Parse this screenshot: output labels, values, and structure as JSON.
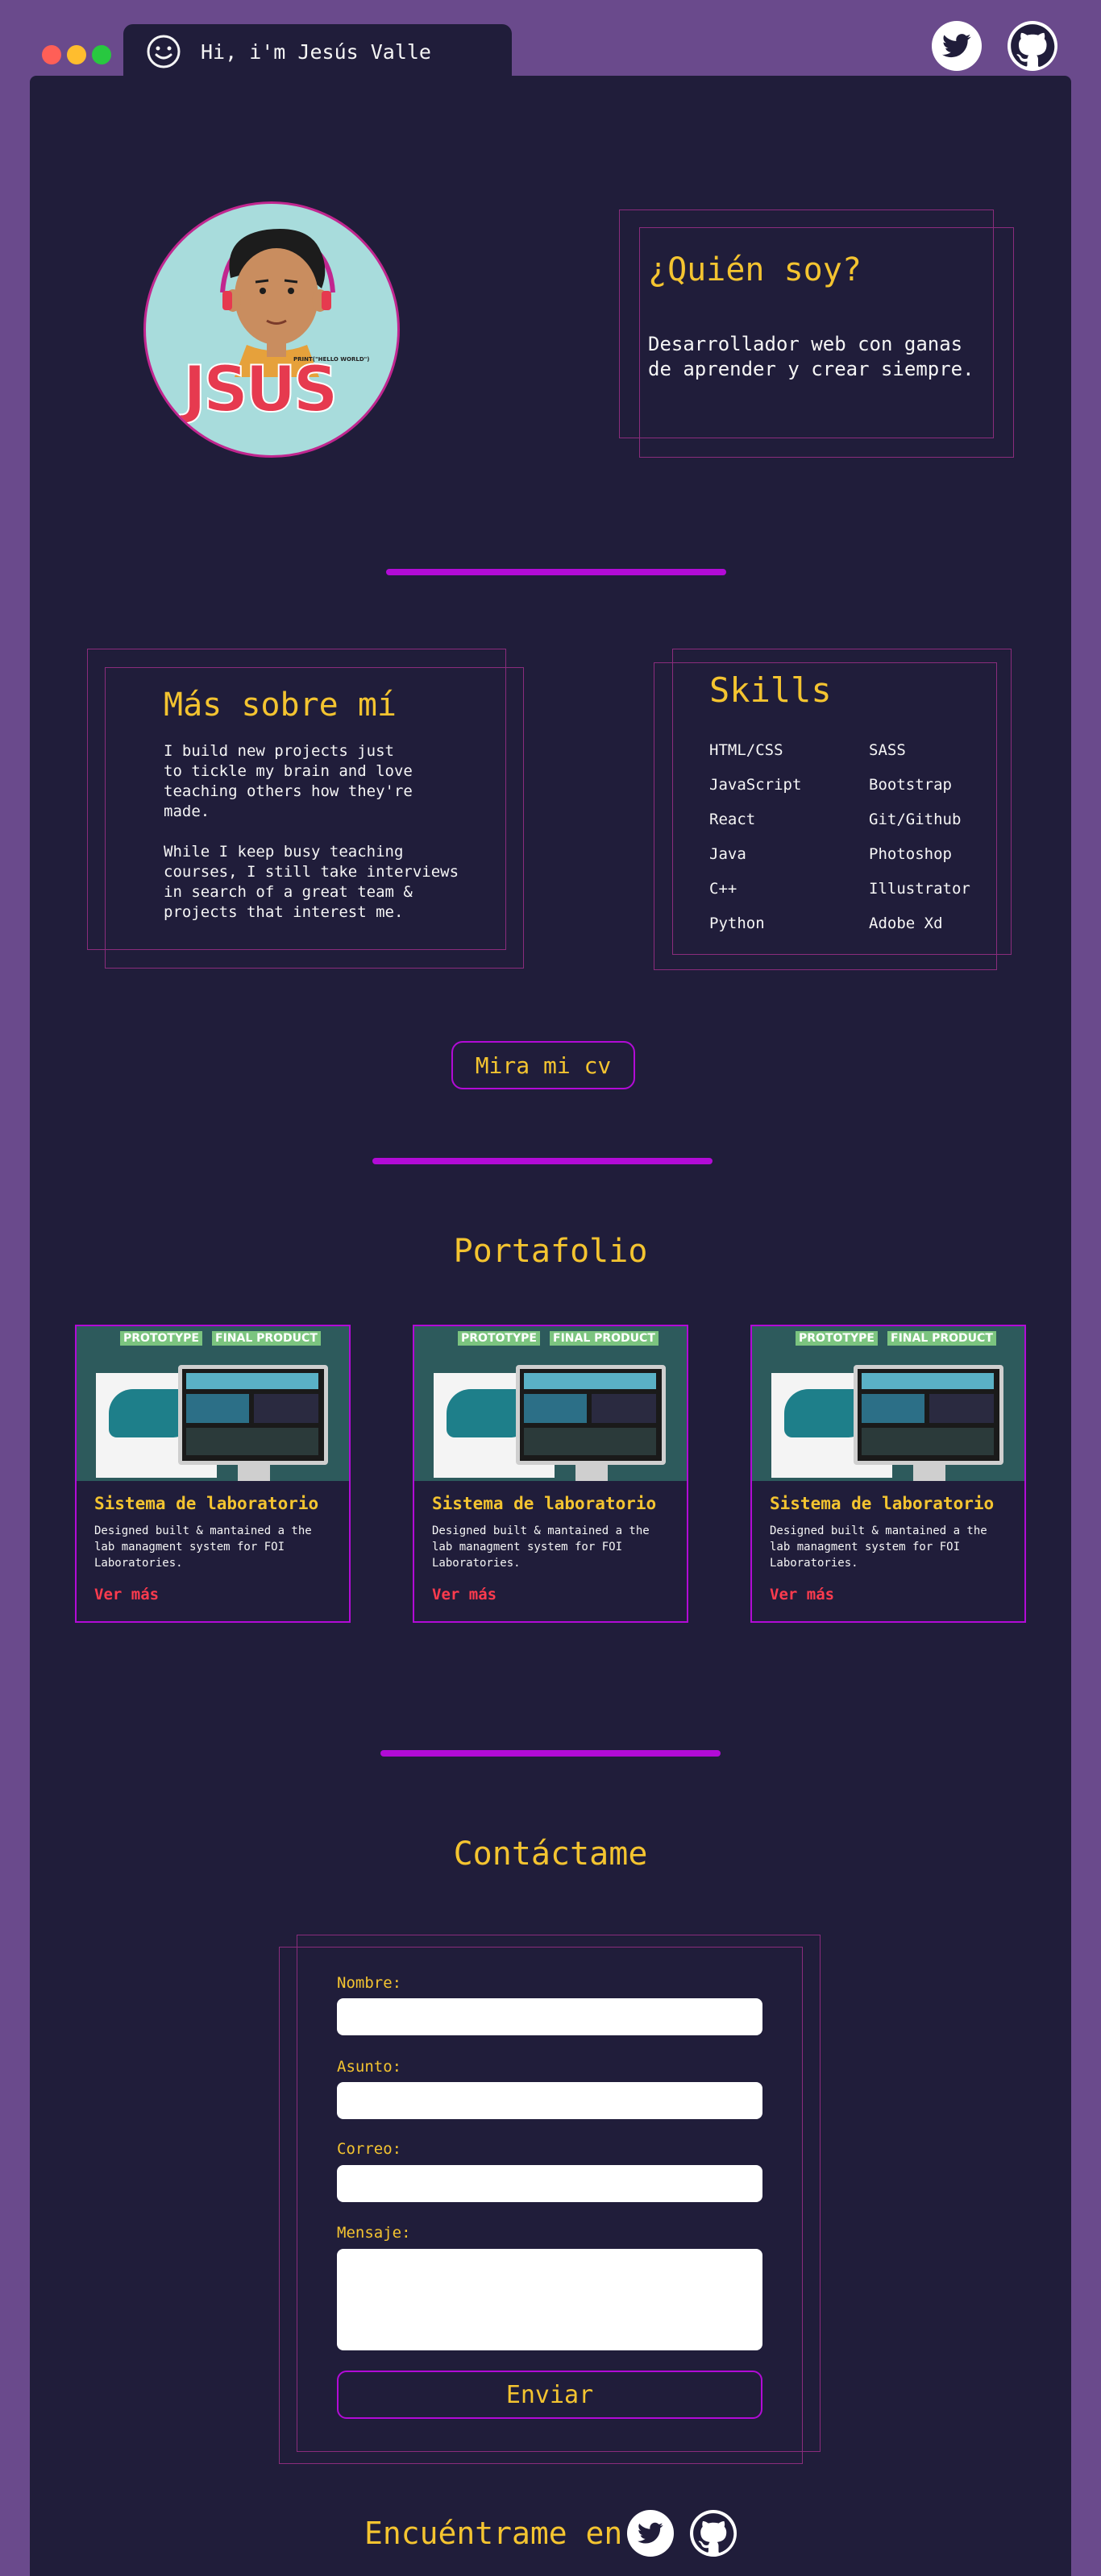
{
  "window": {
    "title": "Hi, i'm Jesús Valle",
    "controls": {
      "close_color": "#ff5f57",
      "minimize_color": "#ffbd2e",
      "maximize_color": "#28c840"
    }
  },
  "header_social": [
    "twitter-icon",
    "github-icon"
  ],
  "about": {
    "avatar_text": "JSUS",
    "avatar_small_text": "PRINT(\"HELLO WORLD\")",
    "who_title": "¿Quién soy?",
    "who_text": "Desarrollador web con ganas de aprender y crear siempre."
  },
  "more": {
    "title": "Más sobre mí",
    "text": "I build new projects just\nto tickle my brain and love\nteaching others how they're\nmade.\n\nWhile I keep busy teaching\ncourses, I still take interviews\nin search of a great team &\nprojects that interest me."
  },
  "skills": {
    "title": "Skills",
    "left": [
      "HTML/CSS",
      "JavaScript",
      "React",
      "Java",
      "C++",
      "Python"
    ],
    "right": [
      "SASS",
      "Bootstrap",
      "Git/Github",
      "Photoshop",
      "Illustrator",
      "Adobe Xd"
    ]
  },
  "cv_button": "Mira mi cv",
  "portfolio": {
    "title": "Portafolio",
    "cards": [
      {
        "title": "Sistema de laboratorio",
        "desc": "Designed built & mantained a the lab managment system for FOI Laboratories.",
        "link": "Ver más",
        "tag1": "PROTOTYPE",
        "tag2": "FINAL PRODUCT"
      },
      {
        "title": "Sistema de laboratorio",
        "desc": "Designed built & mantained a the lab managment system for FOI Laboratories.",
        "link": "Ver más",
        "tag1": "PROTOTYPE",
        "tag2": "FINAL PRODUCT"
      },
      {
        "title": "Sistema de laboratorio",
        "desc": "Designed built & mantained a the lab managment system for FOI Laboratories.",
        "link": "Ver más",
        "tag1": "PROTOTYPE",
        "tag2": "FINAL PRODUCT"
      }
    ]
  },
  "contact": {
    "title": "Contáctame",
    "name_label": "Nombre:",
    "subject_label": "Asunto:",
    "email_label": "Correo:",
    "message_label": "Mensaje:",
    "send_button": "Enviar"
  },
  "footer": {
    "find_text": "Encuéntrame en:",
    "social": [
      "twitter-icon",
      "github-icon"
    ]
  },
  "colors": {
    "background": "#6a4a8c",
    "window": "#201d3a",
    "accent_yellow": "#f4c430",
    "accent_purple": "#b20bd6",
    "link_red": "#ff3b4e"
  }
}
